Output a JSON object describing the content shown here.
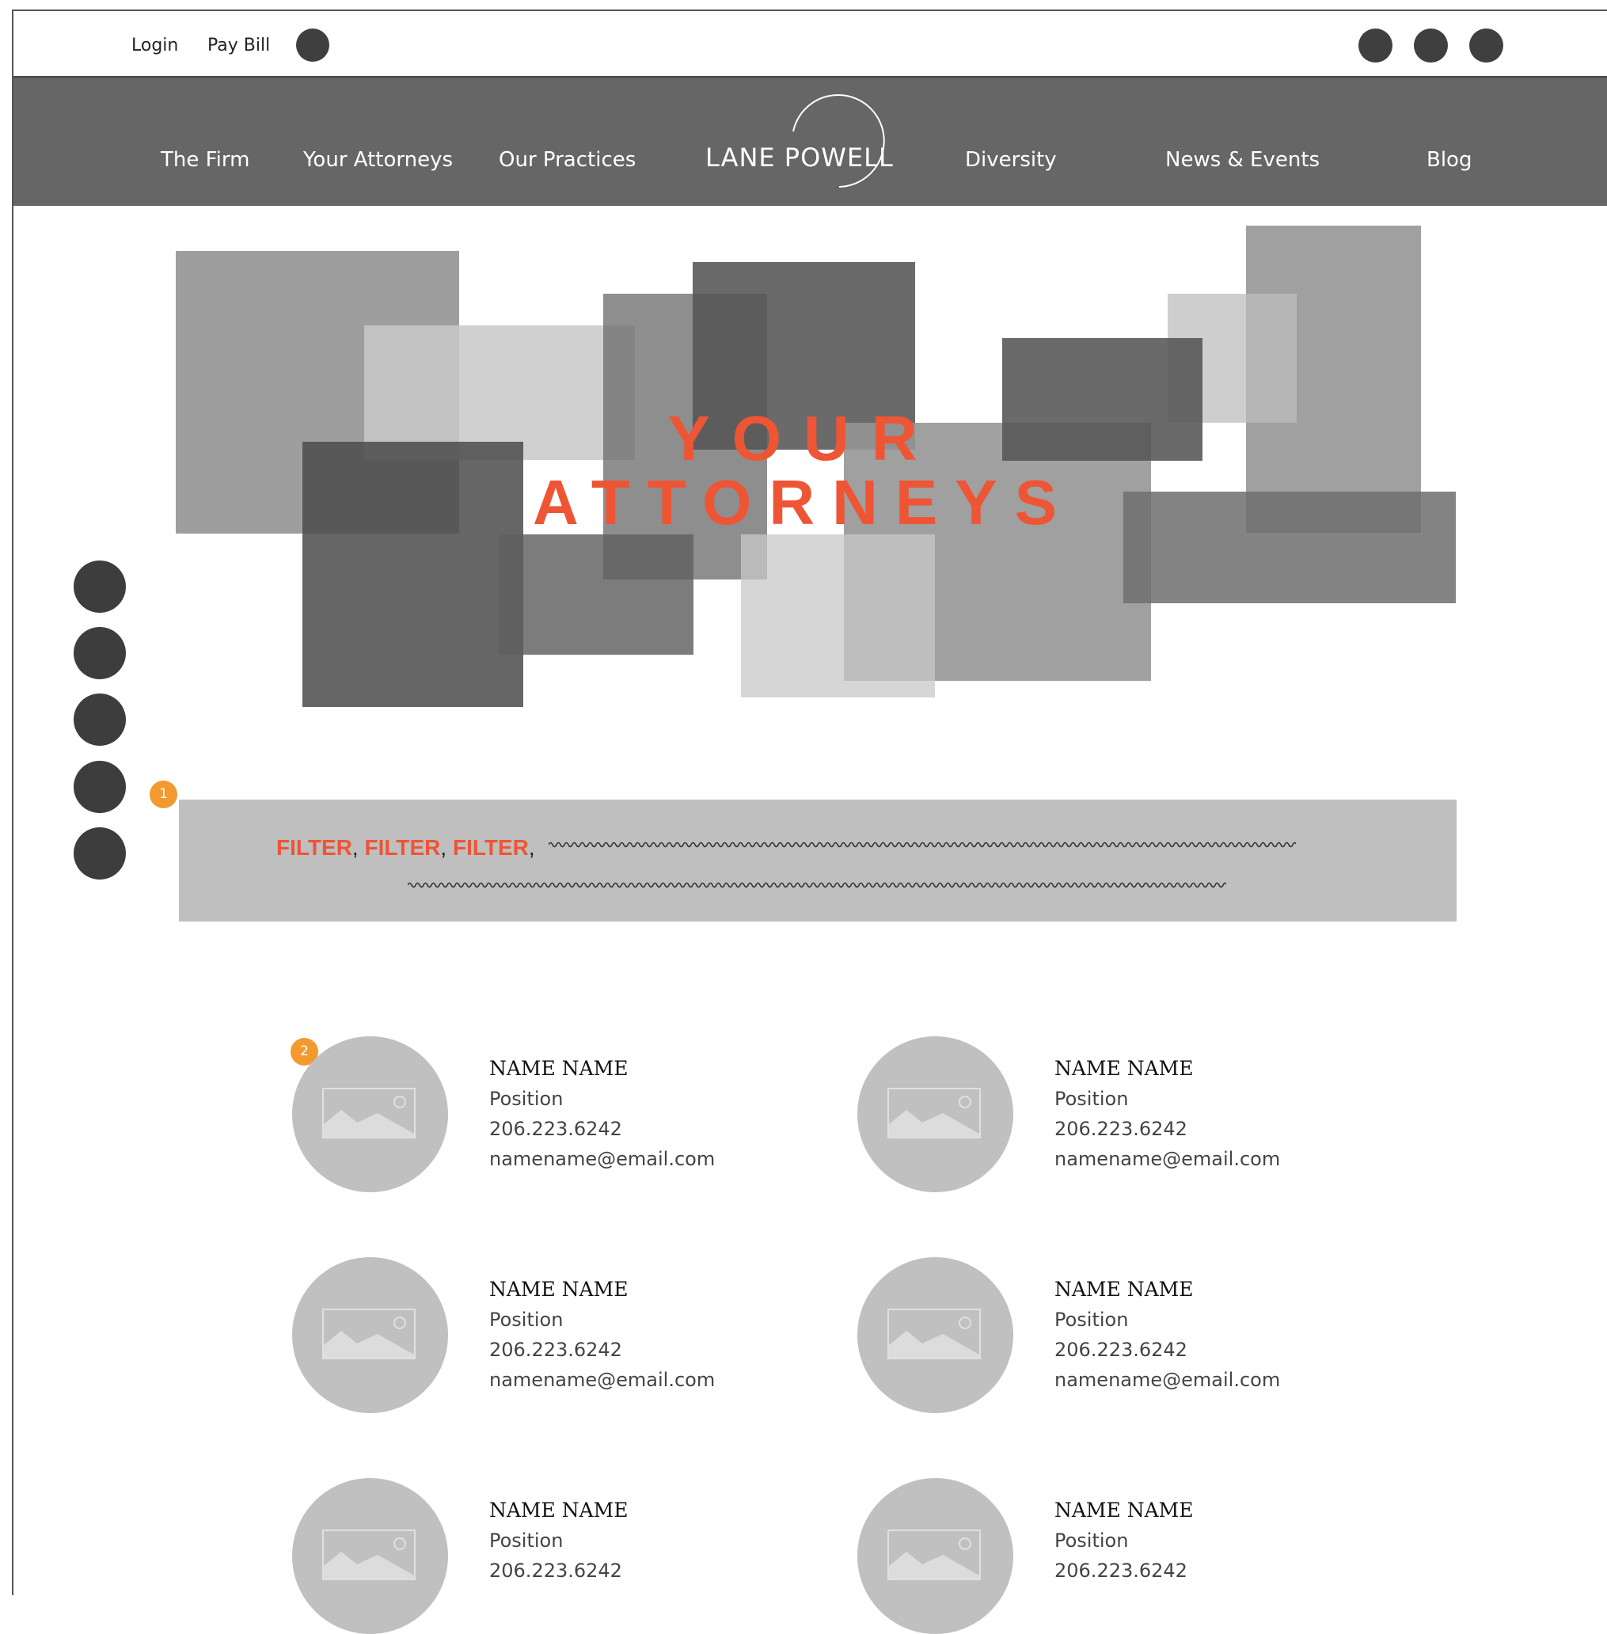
{
  "topbar": {
    "login_label": "Login",
    "paybill_label": "Pay Bill"
  },
  "nav": {
    "items": [
      "The Firm",
      "Your Attorneys",
      "Our Practices",
      "Diversity",
      "News & Events",
      "Blog"
    ],
    "logo": "LANE POWELL"
  },
  "hero": {
    "line1": "YOUR",
    "line2": "ATTORNEYS"
  },
  "annotations": [
    "1",
    "2"
  ],
  "filter": {
    "items": [
      "FILTER",
      "FILTER",
      "FILTER"
    ],
    "separator": ","
  },
  "attorneys": [
    {
      "name": "NAME NAME",
      "position": "Position",
      "phone": "206.223.6242",
      "email": "namename@email.com"
    },
    {
      "name": "NAME NAME",
      "position": "Position",
      "phone": "206.223.6242",
      "email": "namename@email.com"
    },
    {
      "name": "NAME NAME",
      "position": "Position",
      "phone": "206.223.6242",
      "email": "namename@email.com"
    },
    {
      "name": "NAME NAME",
      "position": "Position",
      "phone": "206.223.6242",
      "email": "namename@email.com"
    },
    {
      "name": "NAME NAME",
      "position": "Position",
      "phone": "206.223.6242"
    },
    {
      "name": "NAME NAME",
      "position": "Position",
      "phone": "206.223.6242"
    }
  ],
  "colors": {
    "accent": "#ee5535",
    "nav_bg": "#666666",
    "marker": "#f29a30",
    "filter_bg": "#bfbfbf",
    "avatar_bg": "#c0c0c0"
  }
}
